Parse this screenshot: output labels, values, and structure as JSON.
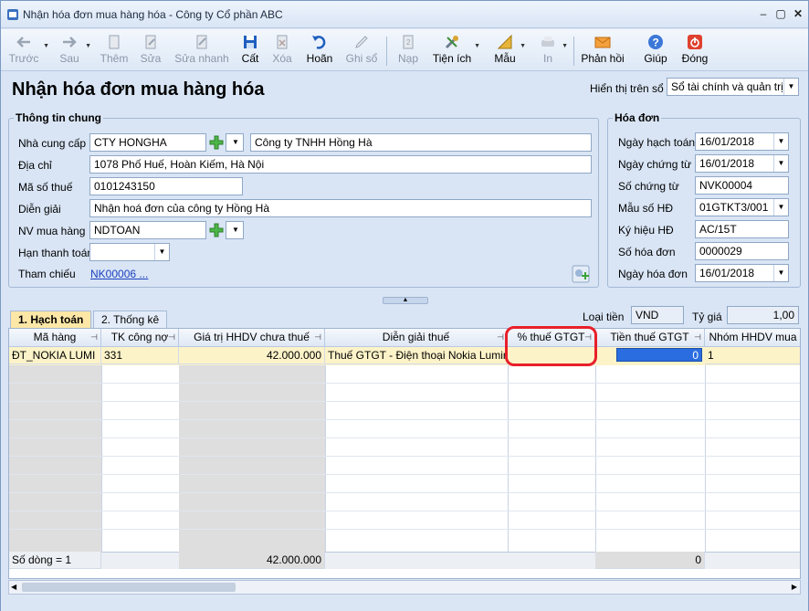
{
  "window": {
    "title": "Nhận hóa đơn mua hàng hóa - Công ty Cổ phần ABC"
  },
  "toolbar": {
    "prev": "Trước",
    "next": "Sau",
    "add": "Thêm",
    "edit": "Sửa",
    "quick_edit": "Sửa nhanh",
    "save": "Cất",
    "delete": "Xóa",
    "undo": "Hoãn",
    "post": "Ghi sổ",
    "load": "Nạp",
    "utility": "Tiện ích",
    "template": "Mẫu",
    "print": "In",
    "feedback": "Phản hồi",
    "help": "Giúp",
    "close": "Đóng"
  },
  "page": {
    "title": "Nhận hóa đơn mua hàng hóa",
    "display_label": "Hiển thị trên sổ",
    "display_value": "Sổ tài chính và quản trị"
  },
  "general": {
    "title": "Thông tin chung",
    "supplier_label": "Nhà cung cấp",
    "supplier_code": "CTY HONGHA",
    "supplier_name": "Công ty TNHH Hồng Hà",
    "address_label": "Địa chỉ",
    "address": "1078 Phố Huế, Hoàn Kiếm, Hà Nội",
    "tax_label": "Mã số thuế",
    "tax": "0101243150",
    "desc_label": "Diễn giải",
    "desc": "Nhận hoá đơn của công ty Hồng Hà",
    "buyer_label": "NV mua hàng",
    "buyer": "NDTOAN",
    "due_label": "Hạn thanh toán",
    "due": "",
    "ref_label": "Tham chiếu",
    "ref": "NK00006 ..."
  },
  "invoice": {
    "title": "Hóa đơn",
    "post_date_label": "Ngày hạch toán",
    "post_date": "16/01/2018",
    "voucher_date_label": "Ngày chứng từ",
    "voucher_date": "16/01/2018",
    "voucher_no_label": "Số chứng từ",
    "voucher_no": "NVK00004",
    "form_label": "Mẫu số HĐ",
    "form": "01GTKT3/001",
    "symbol_label": "Ký hiệu HĐ",
    "symbol": "AC/15T",
    "number_label": "Số hóa đơn",
    "number": "0000029",
    "date_label": "Ngày hóa đơn",
    "date": "16/01/2018"
  },
  "tabs": {
    "accounting": "1. Hạch toán",
    "stats": "2. Thống kê"
  },
  "currency": {
    "label": "Loại tiền",
    "value": "VND",
    "rate_label": "Tỷ giá",
    "rate": "1,00"
  },
  "grid": {
    "columns": [
      "Mã hàng",
      "TK công nợ",
      "Giá trị HHDV chưa thuế",
      "Diễn giải thuế",
      "% thuế GTGT",
      "Tiền thuế GTGT",
      "Nhóm HHDV mua"
    ],
    "row": {
      "item": "ĐT_NOKIA LUMI",
      "account": "331",
      "value": "42.000.000",
      "tax_desc": "Thuế GTGT - Điện thoại Nokia Lumin",
      "tax_pct": "",
      "tax_amount": "0",
      "group": "1"
    },
    "footer": {
      "rows": "Số dòng = 1",
      "value_total": "42.000.000",
      "tax_total": "0"
    }
  },
  "colors": {
    "highlight": "#e8202a",
    "selection": "#2a6de0",
    "active_row": "#fdf3c9"
  }
}
